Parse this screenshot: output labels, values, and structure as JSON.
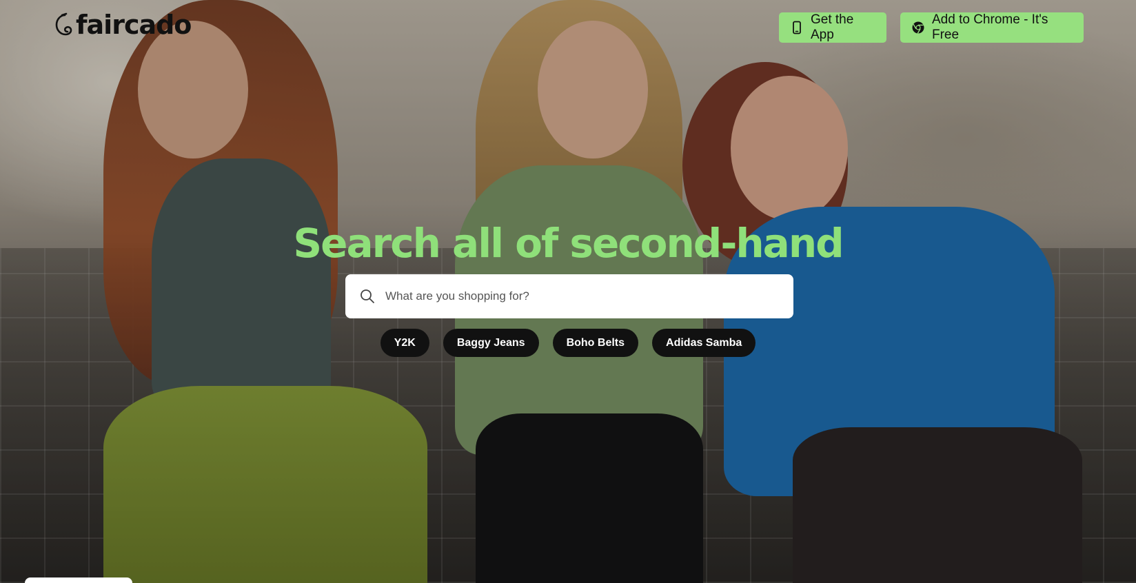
{
  "header": {
    "logo_text": "faircado",
    "get_app_label": "Get the App",
    "add_chrome_label": "Add to Chrome - It's Free"
  },
  "hero": {
    "headline": "Search all of second-hand",
    "search": {
      "placeholder": "What are you shopping for?",
      "value": ""
    },
    "suggestions": [
      "Y2K",
      "Baggy Jeans",
      "Boho Belts",
      "Adidas Samba"
    ]
  },
  "icons": {
    "logo": "faircado-swirl-icon",
    "app": "smartphone-icon",
    "chrome": "chrome-icon",
    "search": "search-icon"
  },
  "colors": {
    "accent_green": "#96e07f",
    "headline_green": "#8fe07a",
    "chip_bg": "#111111"
  }
}
